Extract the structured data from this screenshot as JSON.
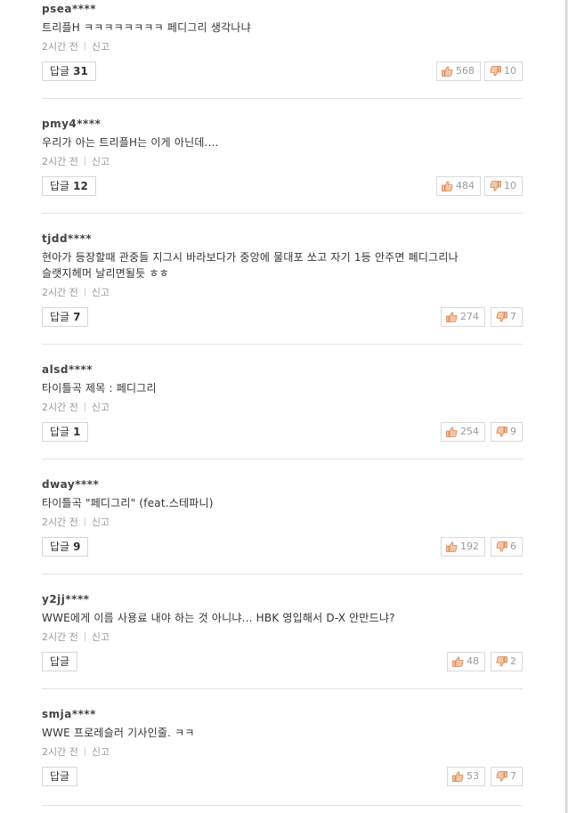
{
  "meta_common": {
    "time": "2시간 전",
    "report": "신고",
    "reply_label": "답글"
  },
  "comments": [
    {
      "username": "psea****",
      "text": "트리플H ㅋㅋㅋㅋㅋㅋㅋㅋ 페디그리 생각나냐",
      "reply_count": "31",
      "likes": "568",
      "dislikes": "10"
    },
    {
      "username": "pmy4****",
      "text": "우리가 아는 트리플H는 이게 아닌데....",
      "reply_count": "12",
      "likes": "484",
      "dislikes": "10"
    },
    {
      "username": "tjdd****",
      "text": "현아가 등장할때 관중들 지그시 바라보다가 중앙에 물대포 쏘고 자기 1등 안주면 페디그리나\n슬랫지헤머 날리면될듯 ㅎㅎ",
      "reply_count": "7",
      "likes": "274",
      "dislikes": "7"
    },
    {
      "username": "alsd****",
      "text": "타이틀곡 제목 : 페디그리",
      "reply_count": "1",
      "likes": "254",
      "dislikes": "9"
    },
    {
      "username": "dway****",
      "text": "타이틀곡 \"페디그리\" (feat.스테파니)",
      "reply_count": "9",
      "likes": "192",
      "dislikes": "6"
    },
    {
      "username": "y2jj****",
      "text": "WWE에게 이름 사용료 내야 하는 것 아니냐... HBK 영입해서 D-X 안만드냐?",
      "reply_count": "",
      "likes": "48",
      "dislikes": "2"
    },
    {
      "username": "smja****",
      "text": "WWE 프로레슬러 기사인줄. ㅋㅋ",
      "reply_count": "",
      "likes": "53",
      "dislikes": "7"
    }
  ]
}
